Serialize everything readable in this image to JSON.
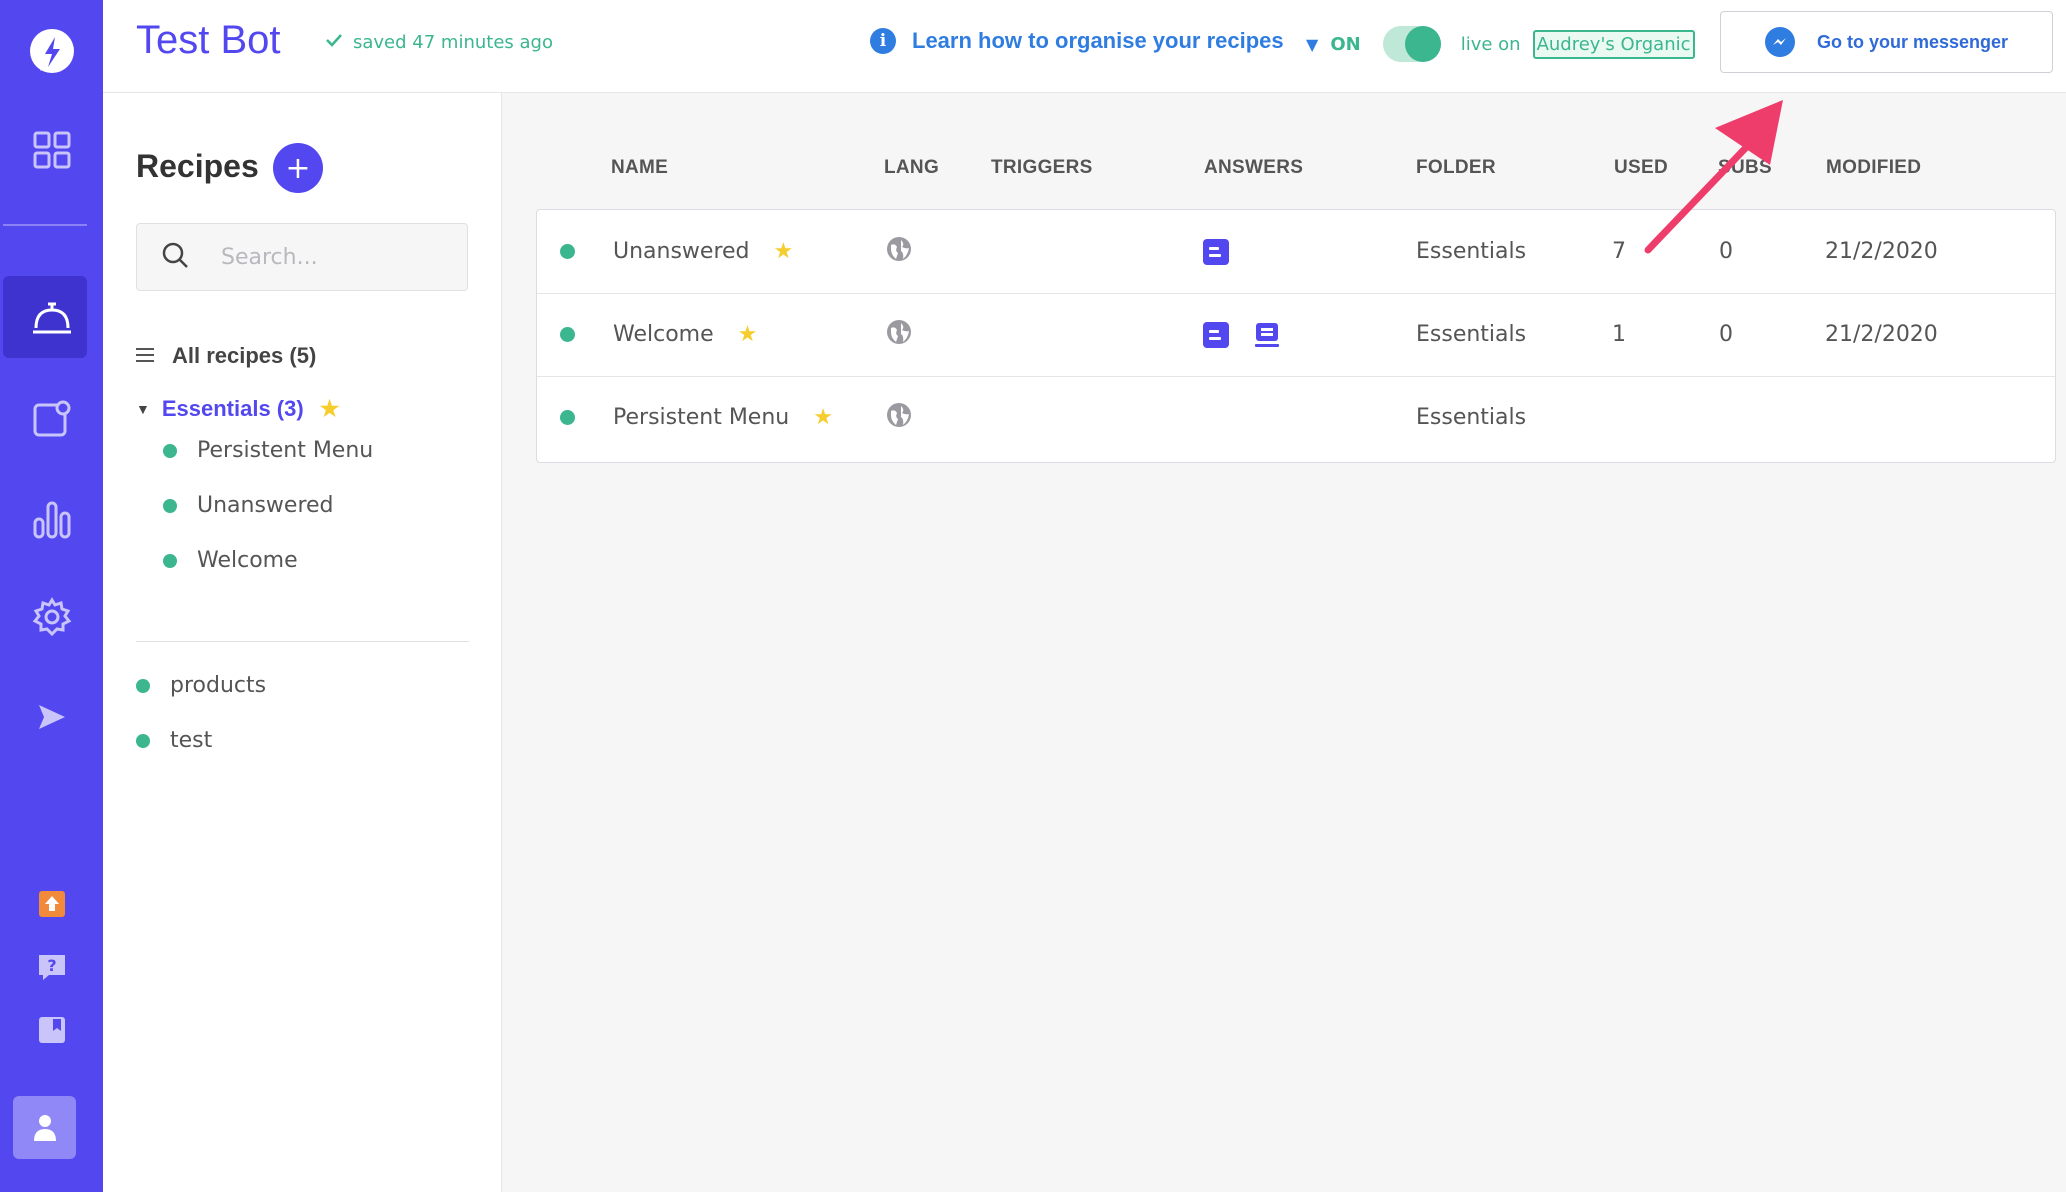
{
  "app": {
    "bot_name": "Test Bot",
    "saved_status": "saved 47 minutes ago"
  },
  "topbar": {
    "learn_link": "Learn how to organise your recipes",
    "status_on": "ON",
    "live_on": "live on",
    "page_name": "Audrey's Organic",
    "messenger_button": "Go to your messenger"
  },
  "nav": {
    "items": [
      "dashboard-icon",
      "recipes-icon",
      "broadcast-icon",
      "analytics-icon",
      "settings-icon",
      "publish-icon"
    ],
    "bottom": [
      "upgrade-icon",
      "help-icon",
      "docs-icon",
      "user-icon"
    ],
    "accent": "#5347f0"
  },
  "recipes_panel": {
    "title": "Recipes",
    "add_label": "+",
    "search_placeholder": "Search...",
    "all_recipes": "All recipes (5)",
    "folder": {
      "name": "Essentials (3)",
      "items": [
        "Persistent Menu",
        "Unanswered",
        "Welcome"
      ]
    },
    "loose_items": [
      "products",
      "test"
    ]
  },
  "table": {
    "headers": {
      "name": "NAME",
      "lang": "LANG",
      "triggers": "TRIGGERS",
      "answers": "ANSWERS",
      "folder": "FOLDER",
      "used": "USED",
      "subs": "SUBS",
      "modified": "MODIFIED"
    },
    "rows": [
      {
        "name": "Unanswered",
        "starred": true,
        "answers": [
          "text-card-icon"
        ],
        "folder": "Essentials",
        "used": "7",
        "subs": "0",
        "modified": "21/2/2020"
      },
      {
        "name": "Welcome",
        "starred": true,
        "answers": [
          "text-card-icon",
          "quick-reply-icon"
        ],
        "folder": "Essentials",
        "used": "1",
        "subs": "0",
        "modified": "21/2/2020"
      },
      {
        "name": "Persistent Menu",
        "starred": true,
        "answers": [],
        "folder": "Essentials",
        "used": "",
        "subs": "",
        "modified": ""
      }
    ]
  },
  "colors": {
    "primary": "#5347f0",
    "success": "#3bb68f",
    "link": "#2f7de1",
    "star": "#f6cd2e",
    "annotation_arrow": "#ee3d6b"
  }
}
